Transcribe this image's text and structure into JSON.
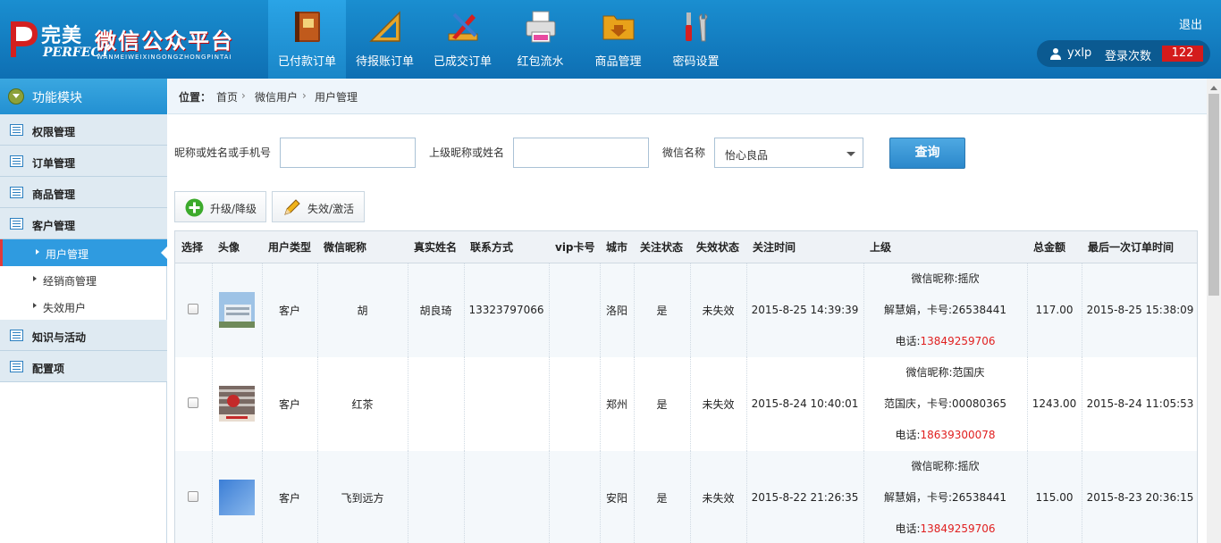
{
  "header": {
    "logo": {
      "cn_brand": "完美",
      "cn_platform": "微信公众平台",
      "en_brand": "PERFECT",
      "en_pinyin": "WANMEIWEIXINGONGZHONGPINTAI"
    },
    "nav": [
      {
        "label": "已付款订单",
        "icon": "book-icon",
        "active": true
      },
      {
        "label": "待报账订单",
        "icon": "ruler-icon",
        "active": false
      },
      {
        "label": "已成交订单",
        "icon": "pencil-ruler-icon",
        "active": false
      },
      {
        "label": "红包流水",
        "icon": "printer-icon",
        "active": false
      },
      {
        "label": "商品管理",
        "icon": "folder-icon",
        "active": false
      },
      {
        "label": "密码设置",
        "icon": "tools-icon",
        "active": false
      }
    ],
    "logout": "退出",
    "user": {
      "name": "yxlp",
      "login_label": "登录次数",
      "login_count": "122"
    }
  },
  "sidebar": {
    "title": "功能模块",
    "groups": [
      "权限管理",
      "订单管理",
      "商品管理",
      "客户管理"
    ],
    "customer_items": [
      "用户管理",
      "经销商管理",
      "失效用户"
    ],
    "groups_after": [
      "知识与活动",
      "配置项"
    ],
    "active_item": "用户管理"
  },
  "breadcrumb": {
    "label": "位置：",
    "items": [
      "首页",
      "微信用户",
      "用户管理"
    ]
  },
  "filters": {
    "nickname_label": "昵称或姓名或手机号",
    "nickname_value": "",
    "superior_label": "上级昵称或姓名",
    "superior_value": "",
    "wechat_label": "微信名称",
    "wechat_selected": "怡心良品",
    "query_button": "查询"
  },
  "toolbar": {
    "upgrade": "升级/降级",
    "toggle": "失效/激活"
  },
  "table": {
    "columns": [
      "选择",
      "头像",
      "用户类型",
      "微信昵称",
      "真实姓名",
      "联系方式",
      "vip卡号",
      "城市",
      "关注状态",
      "失效状态",
      "关注时间",
      "上级",
      "总金额",
      "最后一次订单时间"
    ],
    "rows": [
      {
        "type": "客户",
        "nickname": "胡",
        "real_name": "胡良琦",
        "contact": "13323797066",
        "vip": "",
        "city": "洛阳",
        "follow": "是",
        "invalid": "未失效",
        "follow_time": "2015-8-25 14:39:39",
        "sup_nick": "微信昵称:摇欣",
        "sup_name": "解慧娟，卡号:26538441",
        "sup_phone_label": "电话:",
        "sup_phone": "13849259706",
        "total": "117.00",
        "last_order": "2015-8-25 15:38:09",
        "avatar": "building-photo"
      },
      {
        "type": "客户",
        "nickname": "红茶",
        "real_name": "",
        "contact": "",
        "vip": "",
        "city": "郑州",
        "follow": "是",
        "invalid": "未失效",
        "follow_time": "2015-8-24 10:40:01",
        "sup_nick": "微信昵称:范国庆",
        "sup_name": "范国庆，卡号:00080365",
        "sup_phone_label": "电话:",
        "sup_phone": "18639300078",
        "total": "1243.00",
        "last_order": "2015-8-24 11:05:53",
        "avatar": "storefront-photo"
      },
      {
        "type": "客户",
        "nickname": "飞到远方",
        "real_name": "",
        "contact": "",
        "vip": "",
        "city": "安阳",
        "follow": "是",
        "invalid": "未失效",
        "follow_time": "2015-8-22 21:26:35",
        "sup_nick": "微信昵称:摇欣",
        "sup_name": "解慧娟，卡号:26538441",
        "sup_phone_label": "电话:",
        "sup_phone": "13849259706",
        "total": "115.00",
        "last_order": "2015-8-23 20:36:15",
        "avatar": "sky-photo"
      }
    ]
  },
  "colors": {
    "header_blue": "#0e6fb3",
    "active_blue": "#2f9be0",
    "accent_red": "#e02020"
  }
}
